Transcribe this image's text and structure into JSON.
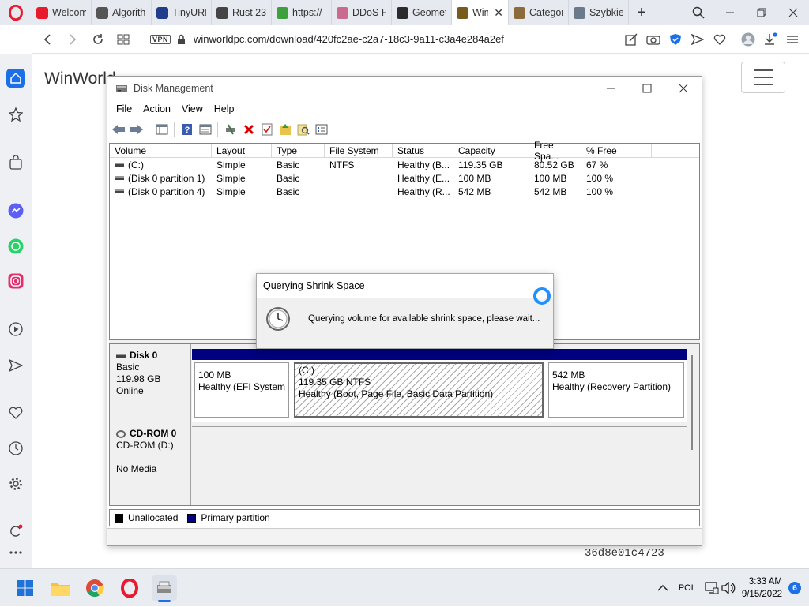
{
  "browser": {
    "tabs": [
      {
        "title": "Welcom",
        "icon": "opera-icon",
        "color": "#e81b2e"
      },
      {
        "title": "Algorith",
        "icon": "github-icon",
        "color": "#555555"
      },
      {
        "title": "TinyURL",
        "icon": "tinyurl-icon",
        "color": "#1e3d8a"
      },
      {
        "title": "Rust 23",
        "icon": "globe-icon",
        "color": "#444444"
      },
      {
        "title": "https://",
        "icon": "upwork-icon",
        "color": "#3da03d"
      },
      {
        "title": "DDoS P",
        "icon": "ddos-icon",
        "color": "#c96a8e"
      },
      {
        "title": "Geomet",
        "icon": "virustotal-icon",
        "color": "#2b2b2b"
      },
      {
        "title": "Win",
        "icon": "winworld-icon",
        "color": "#7a5b1e",
        "active": true
      },
      {
        "title": "Categor",
        "icon": "category-icon",
        "color": "#8b6b3a"
      },
      {
        "title": "Szybkie",
        "icon": "speed-dial-icon",
        "color": "#6a7a8a"
      }
    ],
    "url": "winworldpc.com/download/420fc2ae-c2a7-18c3-9a11-c3a4e284a2ef",
    "vpn_label": "VPN"
  },
  "page": {
    "site_title": "WinWorld",
    "hash_fragment": "36d8e01c4723"
  },
  "disk_management": {
    "title": "Disk Management",
    "menu": [
      "File",
      "Action",
      "View",
      "Help"
    ],
    "columns": [
      "Volume",
      "Layout",
      "Type",
      "File System",
      "Status",
      "Capacity",
      "Free Spa...",
      "% Free"
    ],
    "volumes": [
      {
        "volume": "(C:)",
        "layout": "Simple",
        "type": "Basic",
        "fs": "NTFS",
        "status": "Healthy (B...",
        "capacity": "119.35 GB",
        "free": "80.52 GB",
        "pct": "67 %"
      },
      {
        "volume": "(Disk 0 partition 1)",
        "layout": "Simple",
        "type": "Basic",
        "fs": "",
        "status": "Healthy (E...",
        "capacity": "100 MB",
        "free": "100 MB",
        "pct": "100 %"
      },
      {
        "volume": "(Disk 0 partition 4)",
        "layout": "Simple",
        "type": "Basic",
        "fs": "",
        "status": "Healthy (R...",
        "capacity": "542 MB",
        "free": "542 MB",
        "pct": "100 %"
      }
    ],
    "disk0": {
      "name": "Disk 0",
      "type": "Basic",
      "size": "119.98 GB",
      "state": "Online",
      "partitions": [
        {
          "line1": "100 MB",
          "line2": "Healthy (EFI System P"
        },
        {
          "name": "(C:)",
          "line1": "119.35 GB NTFS",
          "line2": "Healthy (Boot, Page File, Basic Data Partition)"
        },
        {
          "line1": "542 MB",
          "line2": "Healthy (Recovery Partition)"
        }
      ]
    },
    "cdrom": {
      "name": "CD-ROM 0",
      "drive": "CD-ROM (D:)",
      "media": "No Media"
    },
    "legend": {
      "unallocated": "Unallocated",
      "primary": "Primary partition"
    },
    "colors": {
      "unallocated": "#000000",
      "primary": "#000080"
    }
  },
  "dialog": {
    "title": "Querying Shrink Space",
    "message": "Querying volume for available shrink space, please wait..."
  },
  "taskbar": {
    "language": "POL",
    "time": "3:33 AM",
    "date": "9/15/2022",
    "notifications": "6"
  }
}
